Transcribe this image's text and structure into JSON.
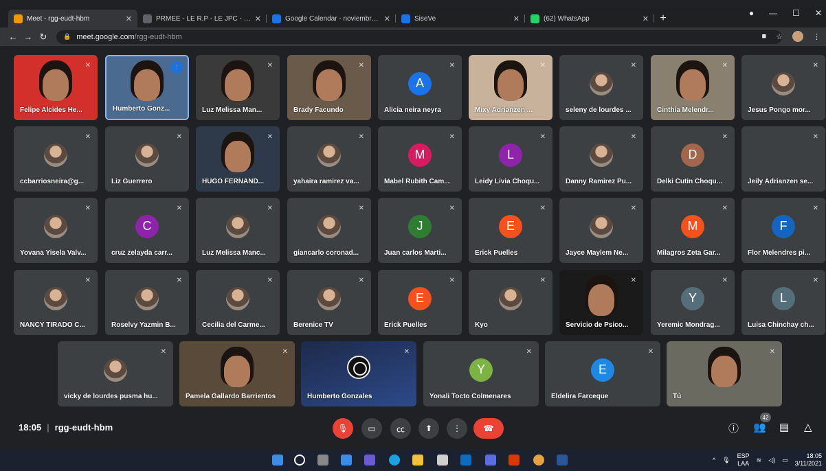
{
  "browser": {
    "tabs": [
      {
        "title": "Meet - rgg-eudt-hbm",
        "color": "#f29900",
        "active": true
      },
      {
        "title": "PRMEE - LE R.P - LE JPC - LE SM",
        "color": "#5f6368",
        "active": false
      },
      {
        "title": "Google Calendar - noviembre de",
        "color": "#1a73e8",
        "active": false
      },
      {
        "title": "SiseVe",
        "color": "#1a73e8",
        "active": false
      },
      {
        "title": "(62) WhatsApp",
        "color": "#25d366",
        "active": false
      }
    ],
    "url_host": "meet.google.com",
    "url_path": "/rgg-eudt-hbm"
  },
  "participants": [
    {
      "name": "Felipe Alcides He...",
      "type": "video",
      "bg": "#d4302b",
      "speaking": false
    },
    {
      "name": "Humberto Gonz...",
      "type": "video",
      "bg": "#4a6a90",
      "speaking": true
    },
    {
      "name": "Luz Melissa Man...",
      "type": "video",
      "bg": "#3a3a3a",
      "speaking": false
    },
    {
      "name": "Brady Facundo",
      "type": "video",
      "bg": "#6a5a4a",
      "speaking": false
    },
    {
      "name": "Alicia neira neyra",
      "type": "letter",
      "letter": "A",
      "color": "#1a73e8"
    },
    {
      "name": "Mixy Adrianzen ...",
      "type": "video",
      "bg": "#c8b29b",
      "speaking": false
    },
    {
      "name": "seleny de lourdes ...",
      "type": "photo"
    },
    {
      "name": "Cinthia Melendr...",
      "type": "video",
      "bg": "#8a8070",
      "speaking": false
    },
    {
      "name": "Jesus Pongo mor...",
      "type": "photo"
    },
    {
      "name": "ccbarriosneira@g...",
      "type": "photo"
    },
    {
      "name": "Liz Guerrero",
      "type": "photo"
    },
    {
      "name": "HUGO FERNAND...",
      "type": "video",
      "bg": "#2e3a4a",
      "speaking": false
    },
    {
      "name": "yahaira ramirez va...",
      "type": "photo"
    },
    {
      "name": "Mabel Rubith Cam...",
      "type": "letter",
      "letter": "M",
      "color": "#d81b60"
    },
    {
      "name": "Leidy Livia Choqu...",
      "type": "letter",
      "letter": "L",
      "color": "#8e24aa"
    },
    {
      "name": "Danny Ramirez Pu...",
      "type": "photo"
    },
    {
      "name": "Delki Cutin Choqu...",
      "type": "letter",
      "letter": "D",
      "color": "#a1664b"
    },
    {
      "name": "Jeily Adrianzen se...",
      "type": "none"
    },
    {
      "name": "Yovana Yisela Valv...",
      "type": "photo"
    },
    {
      "name": "cruz zelayda carr...",
      "type": "letter",
      "letter": "C",
      "color": "#8e24aa"
    },
    {
      "name": "Luz Melissa Manc...",
      "type": "photo"
    },
    {
      "name": "giancarlo coronad...",
      "type": "photo"
    },
    {
      "name": "Juan carlos Marti...",
      "type": "letter",
      "letter": "J",
      "color": "#2e7d32"
    },
    {
      "name": "Erick Puelles",
      "type": "letter",
      "letter": "E",
      "color": "#f4511e"
    },
    {
      "name": "Jayce Maylem Ne...",
      "type": "photo"
    },
    {
      "name": "Milagros Zeta Gar...",
      "type": "letter",
      "letter": "M",
      "color": "#f4511e"
    },
    {
      "name": "Flor Melendres pi...",
      "type": "letter",
      "letter": "F",
      "color": "#1565c0"
    },
    {
      "name": "NANCY TIRADO C...",
      "type": "photo"
    },
    {
      "name": "Roselvy Yazmin B...",
      "type": "photo"
    },
    {
      "name": "Cecilia del Carme...",
      "type": "photo"
    },
    {
      "name": "Berenice TV",
      "type": "photo"
    },
    {
      "name": "Erick Puelles",
      "type": "letter",
      "letter": "E",
      "color": "#f4511e"
    },
    {
      "name": "Kyo",
      "type": "photo"
    },
    {
      "name": "Servicio de Psico...",
      "type": "video",
      "bg": "#1a1a1a",
      "speaking": false
    },
    {
      "name": "Yeremic Mondrag...",
      "type": "letter",
      "letter": "Y",
      "color": "#546e7a"
    },
    {
      "name": "Luisa Chinchay ch...",
      "type": "letter",
      "letter": "L",
      "color": "#546e7a"
    }
  ],
  "row5": [
    {
      "name": "vicky de lourdes pusma hu...",
      "type": "photo"
    },
    {
      "name": "Pamela Gallardo Barrientos",
      "type": "video",
      "bg": "#5a4a3a"
    },
    {
      "name": "Humberto Gonzales",
      "type": "obs"
    },
    {
      "name": "Yonali Tocto Colmenares",
      "type": "letter",
      "letter": "Y",
      "color": "#7cb342"
    },
    {
      "name": "Eldelira Farceque",
      "type": "letter",
      "letter": "E",
      "color": "#1e88e5"
    },
    {
      "name": "Tú",
      "type": "video",
      "bg": "#6a6a60"
    }
  ],
  "meeting": {
    "time": "18:05",
    "code": "rgg-eudt-hbm",
    "participant_count": "42"
  },
  "taskbar": {
    "lang1": "ESP",
    "lang2": "LAA",
    "time": "18:05",
    "date": "3/11/2021"
  }
}
